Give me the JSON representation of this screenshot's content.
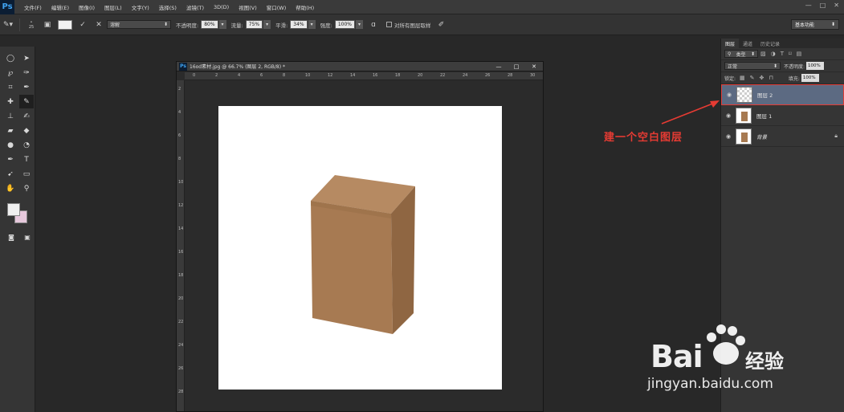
{
  "app": {
    "logo": "Ps"
  },
  "menu": [
    "文件(F)",
    "编辑(E)",
    "图像(I)",
    "图层(L)",
    "文字(Y)",
    "选择(S)",
    "滤镜(T)",
    "3D(D)",
    "视图(V)",
    "窗口(W)",
    "帮助(H)"
  ],
  "window_controls": [
    "—",
    "□",
    "✕"
  ],
  "options": {
    "brush_size": "25",
    "mode_value": "溶解",
    "opacity_label": "不透明度:",
    "opacity_value": "80%",
    "flow_label": "流量:",
    "flow_value": "75%",
    "smooth_label": "平滑:",
    "smooth_value": "34%",
    "strength_label": "强度:",
    "strength_value": "100%",
    "sample_all_label": "对所有图层取样",
    "workspace": "基本功能"
  },
  "document": {
    "title": "16od素材.jpg @ 66.7% (图层 2, RGB/8) *",
    "ruler_top": [
      "0",
      "2",
      "4",
      "6",
      "8",
      "10",
      "12",
      "14",
      "16",
      "18",
      "20",
      "22",
      "24",
      "26",
      "28",
      "30"
    ],
    "ruler_left": [
      "2",
      "4",
      "6",
      "8",
      "10",
      "12",
      "14",
      "16",
      "18",
      "20",
      "22",
      "24",
      "26",
      "28"
    ]
  },
  "layers_panel": {
    "tabs": [
      "图层",
      "通道",
      "历史记录"
    ],
    "filter_type": "类型",
    "blend_mode": "正常",
    "opacity_label": "不透明度:",
    "opacity_value": "100%",
    "lock_label": "锁定:",
    "fill_label": "填充:",
    "fill_value": "100%",
    "layers": [
      {
        "name": "图层 2",
        "selected": true,
        "thumb": "transparent"
      },
      {
        "name": "图层 1",
        "selected": false,
        "thumb": "box"
      },
      {
        "name": "背景",
        "selected": false,
        "thumb": "box",
        "locked": true
      }
    ]
  },
  "annotation": {
    "text": "建一个空白图层",
    "color": "#e63b33"
  },
  "watermark": {
    "brand": "Bai",
    "brand2": "经验",
    "url": "jingyan.baidu.com"
  },
  "colors": {
    "selection_border": "#e23b35",
    "layer_selected": "#5c6a82",
    "foreground": "#f0f0f0",
    "background": "#e6c8dc"
  }
}
